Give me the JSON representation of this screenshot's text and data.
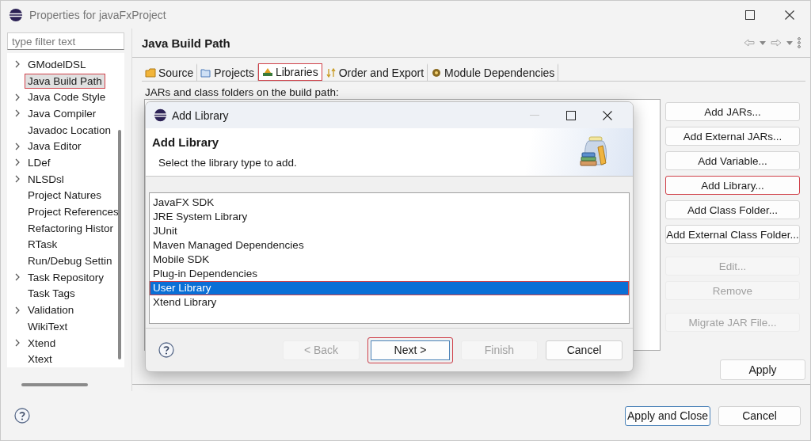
{
  "window": {
    "title": "Properties for javaFxProject"
  },
  "filter": {
    "placeholder": "type filter text"
  },
  "tree": [
    {
      "label": "GModelDSL",
      "expandable": true,
      "selected": false,
      "highlighted": false
    },
    {
      "label": "Java Build Path",
      "expandable": false,
      "selected": true,
      "highlighted": true
    },
    {
      "label": "Java Code Style",
      "expandable": true,
      "selected": false,
      "highlighted": false
    },
    {
      "label": "Java Compiler",
      "expandable": true,
      "selected": false,
      "highlighted": false
    },
    {
      "label": "Javadoc Location",
      "expandable": false,
      "selected": false,
      "highlighted": false
    },
    {
      "label": "Java Editor",
      "expandable": true,
      "selected": false,
      "highlighted": false
    },
    {
      "label": "LDef",
      "expandable": true,
      "selected": false,
      "highlighted": false
    },
    {
      "label": "NLSDsl",
      "expandable": true,
      "selected": false,
      "highlighted": false
    },
    {
      "label": "Project Natures",
      "expandable": false,
      "selected": false,
      "highlighted": false
    },
    {
      "label": "Project References",
      "expandable": false,
      "selected": false,
      "highlighted": false
    },
    {
      "label": "Refactoring Histor",
      "expandable": false,
      "selected": false,
      "highlighted": false
    },
    {
      "label": "RTask",
      "expandable": false,
      "selected": false,
      "highlighted": false
    },
    {
      "label": "Run/Debug Settin",
      "expandable": false,
      "selected": false,
      "highlighted": false
    },
    {
      "label": "Task Repository",
      "expandable": true,
      "selected": false,
      "highlighted": false
    },
    {
      "label": "Task Tags",
      "expandable": false,
      "selected": false,
      "highlighted": false
    },
    {
      "label": "Validation",
      "expandable": true,
      "selected": false,
      "highlighted": false
    },
    {
      "label": "WikiText",
      "expandable": false,
      "selected": false,
      "highlighted": false
    },
    {
      "label": "Xtend",
      "expandable": true,
      "selected": false,
      "highlighted": false
    },
    {
      "label": "Xtext",
      "expandable": false,
      "selected": false,
      "highlighted": false
    }
  ],
  "page": {
    "title": "Java Build Path",
    "tabs": [
      {
        "label": "Source",
        "selected": false,
        "highlighted": false
      },
      {
        "label": "Projects",
        "selected": false,
        "highlighted": false
      },
      {
        "label": "Libraries",
        "selected": true,
        "highlighted": true
      },
      {
        "label": "Order and Export",
        "selected": false,
        "highlighted": false
      },
      {
        "label": "Module Dependencies",
        "selected": false,
        "highlighted": false
      }
    ],
    "description": "JARs and class folders on the build path:",
    "buttons": [
      {
        "label": "Add JARs...",
        "disabled": false,
        "highlighted": false
      },
      {
        "label": "Add External JARs...",
        "disabled": false,
        "highlighted": false
      },
      {
        "label": "Add Variable...",
        "disabled": false,
        "highlighted": false
      },
      {
        "label": "Add Library...",
        "disabled": false,
        "highlighted": true
      },
      {
        "label": "Add Class Folder...",
        "disabled": false,
        "highlighted": false
      },
      {
        "label": "Add External Class Folder...",
        "disabled": false,
        "highlighted": false
      },
      {
        "label": "Edit...",
        "disabled": true,
        "highlighted": false
      },
      {
        "label": "Remove",
        "disabled": true,
        "highlighted": false
      },
      {
        "label": "Migrate JAR File...",
        "disabled": true,
        "highlighted": false
      }
    ],
    "apply": "Apply"
  },
  "footer": {
    "buttons": [
      {
        "label": "Apply and Close",
        "default": true
      },
      {
        "label": "Cancel",
        "default": false
      }
    ]
  },
  "dialog": {
    "title": "Add Library",
    "heading": "Add Library",
    "message": "Select the library type to add.",
    "items": [
      {
        "label": "JavaFX SDK",
        "selected": false,
        "highlighted": false
      },
      {
        "label": "JRE System Library",
        "selected": false,
        "highlighted": false
      },
      {
        "label": "JUnit",
        "selected": false,
        "highlighted": false
      },
      {
        "label": "Maven Managed Dependencies",
        "selected": false,
        "highlighted": false
      },
      {
        "label": "Mobile SDK",
        "selected": false,
        "highlighted": false
      },
      {
        "label": "Plug-in Dependencies",
        "selected": false,
        "highlighted": false
      },
      {
        "label": "User Library",
        "selected": true,
        "highlighted": true
      },
      {
        "label": "Xtend Library",
        "selected": false,
        "highlighted": false
      }
    ],
    "buttons": [
      {
        "label": "< Back",
        "disabled": true,
        "default": false,
        "highlighted": false
      },
      {
        "label": "Next >",
        "disabled": false,
        "default": true,
        "highlighted": true
      },
      {
        "label": "Finish",
        "disabled": true,
        "default": false,
        "highlighted": false
      },
      {
        "label": "Cancel",
        "disabled": false,
        "default": false,
        "highlighted": false
      }
    ]
  }
}
